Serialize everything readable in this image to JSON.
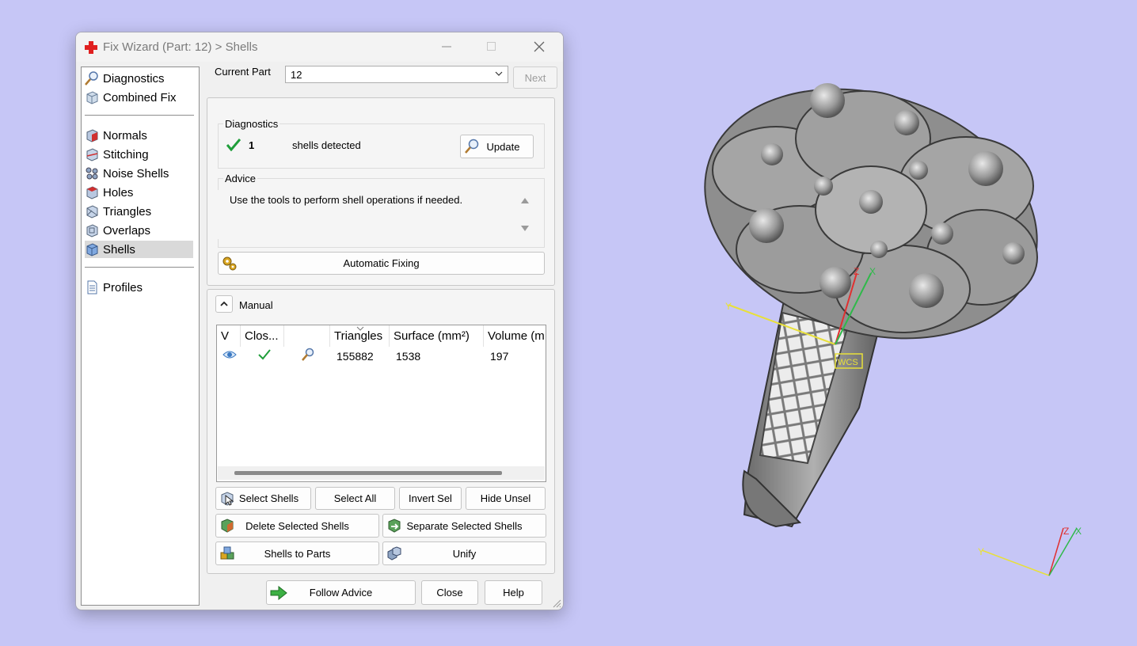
{
  "window": {
    "title": "Fix Wizard (Part: 12) > Shells",
    "minimize_icon": "minimize-icon",
    "maximize_icon": "maximize-icon",
    "close_icon": "close-icon"
  },
  "nav": {
    "items_top": [
      {
        "label": "Diagnostics",
        "icon": "magnifier-icon"
      },
      {
        "label": "Combined Fix",
        "icon": "cube-icon"
      }
    ],
    "items_middle": [
      {
        "label": "Normals",
        "icon": "normals-icon"
      },
      {
        "label": "Stitching",
        "icon": "stitching-icon"
      },
      {
        "label": "Noise Shells",
        "icon": "noise-shells-icon"
      },
      {
        "label": "Holes",
        "icon": "holes-icon"
      },
      {
        "label": "Triangles",
        "icon": "triangles-icon"
      },
      {
        "label": "Overlaps",
        "icon": "overlaps-icon"
      },
      {
        "label": "Shells",
        "icon": "shells-icon",
        "selected": true
      }
    ],
    "items_bottom": [
      {
        "label": "Profiles",
        "icon": "document-icon"
      }
    ]
  },
  "current_part": {
    "label": "Current Part",
    "value": "12",
    "next_label": "Next"
  },
  "diagnostics": {
    "title": "Diagnostics",
    "count": "1",
    "status_text": "shells detected",
    "update_label": "Update"
  },
  "advice": {
    "title": "Advice",
    "text": "Use the tools to perform shell operations if needed."
  },
  "automatic_fixing_label": "Automatic Fixing",
  "manual": {
    "label": "Manual",
    "columns": [
      "V",
      "Clos...",
      "",
      "Triangles",
      "Surface (mm²)",
      "Volume (m"
    ],
    "rows": [
      {
        "triangles": "155882",
        "surface": "1538",
        "volume": "197"
      }
    ]
  },
  "buttons": {
    "select_shells": "Select Shells",
    "select_all": "Select All",
    "invert_sel": "Invert Sel",
    "hide_unsel": "Hide Unsel",
    "delete_selected": "Delete Selected Shells",
    "separate_selected": "Separate Selected Shells",
    "shells_to_parts": "Shells to Parts",
    "unify": "Unify",
    "follow_advice": "Follow Advice",
    "close": "Close",
    "help": "Help"
  },
  "viewport": {
    "background": "#c6c6f6",
    "local_axis": {
      "x": "X",
      "y": "Y",
      "z": "Z",
      "tag": "WCS"
    },
    "triad": {
      "x": "X",
      "y": "Y",
      "z": "Z"
    }
  },
  "colors": {
    "check_green": "#1f9e3a",
    "axis_x": "#2fb94a",
    "axis_y": "#e8e03a",
    "axis_z": "#e03030"
  }
}
